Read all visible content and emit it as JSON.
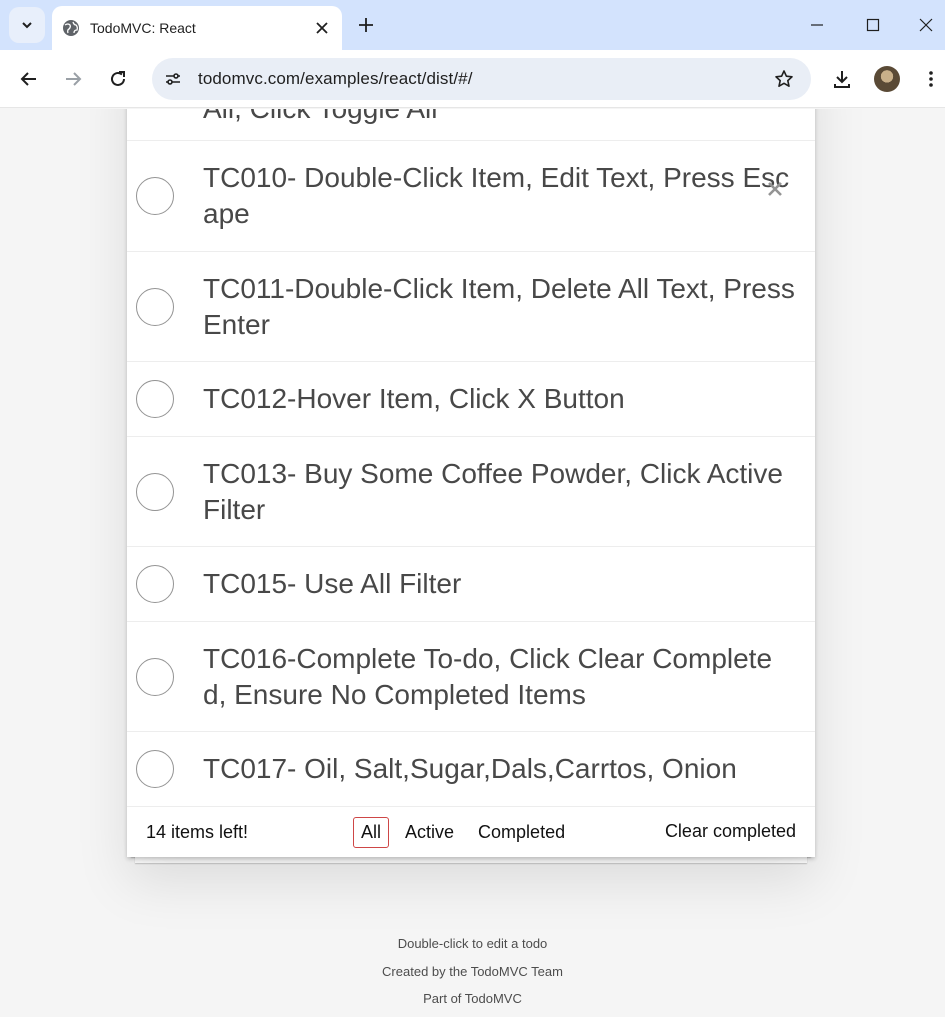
{
  "browser": {
    "tab_title": "TodoMVC: React",
    "url": "todomvc.com/examples/react/dist/#/"
  },
  "todos": [
    {
      "label": "All, Click Toggle All",
      "completed": false,
      "partial": true
    },
    {
      "label": "TC010- Double-Click Item, Edit Text, Press Escape",
      "completed": false,
      "hovered": true
    },
    {
      "label": "TC011-Double-Click Item, Delete All Text, Press Enter",
      "completed": false
    },
    {
      "label": "TC012-Hover Item, Click X Button",
      "completed": false
    },
    {
      "label": "TC013- Buy Some Coffee Powder, Click Active Filter",
      "completed": false
    },
    {
      "label": "TC015- Use All Filter",
      "completed": false
    },
    {
      "label": "TC016-Complete To-do, Click Clear Completed, Ensure No Completed Items",
      "completed": false
    },
    {
      "label": "TC017- Oil, Salt,Sugar,Dals,Carrtos, Onion",
      "completed": false
    }
  ],
  "footer": {
    "count_text": "14 items left!",
    "filters": [
      "All",
      "Active",
      "Completed"
    ],
    "selected_filter": "All",
    "clear_label": "Clear completed"
  },
  "info": {
    "line1": "Double-click to edit a todo",
    "line2": "Created by the TodoMVC Team",
    "line3": "Part of TodoMVC"
  },
  "colors": {
    "titlebar": "#d3e3fd",
    "omnibox": "#e9eef6",
    "filter_selected_border": "#ce4646"
  }
}
